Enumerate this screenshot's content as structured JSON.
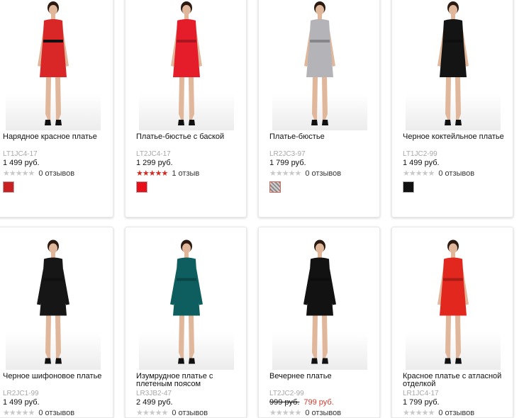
{
  "colors": {
    "accent": "#d62a20",
    "sale_price": "#d23a2e",
    "sku_gray": "#a8a8a8"
  },
  "products": [
    {
      "title": "Нарядное красное платье",
      "sku": "LT1JC4-17",
      "price": "1 499 руб.",
      "stars": 0,
      "reviews": "0 отзывов",
      "color": "#cc1f22",
      "dress": "#d92626",
      "sleeves": false,
      "icon": "dress-red-belted-icon"
    },
    {
      "title": "Платье-бюстье с баской",
      "sku": "LT2JC4-17",
      "price": "1 299 руб.",
      "stars": 5,
      "reviews": "1 отзыв",
      "color": "#e8101a",
      "dress": "#e51c2a",
      "sleeves": false,
      "icon": "dress-red-peplum-icon"
    },
    {
      "title": "Платье-бюстье",
      "sku": "LR2JC3-97",
      "price": "1 799 руб.",
      "stars": 0,
      "reviews": "0 отзывов",
      "color": "pattern",
      "dress": "#b4b4b8",
      "sleeves": false,
      "icon": "dress-silver-bustier-icon"
    },
    {
      "title": "Черное коктейльное платье",
      "sku": "LT1JC2-99",
      "price": "1 499 руб.",
      "stars": 0,
      "reviews": "0 отзывов",
      "color": "#111111",
      "dress": "#141414",
      "sleeves": false,
      "icon": "dress-black-cocktail-icon"
    },
    {
      "title": "Черное шифоновое платье",
      "sku": "LR2JC1-99",
      "price": "1 499 руб.",
      "stars": 0,
      "reviews": "0 отзывов",
      "color": "#111111",
      "dress": "#161616",
      "sleeves": true,
      "icon": "dress-black-chiffon-icon"
    },
    {
      "title": "Изумрудное платье с плетеным поясом",
      "sku": "LR3JB2-47",
      "price": "2 499 руб.",
      "stars": 0,
      "reviews": "0 отзывов",
      "color": "#0b5a57",
      "dress": "#0f5e5f",
      "sleeves": true,
      "icon": "dress-emerald-icon"
    },
    {
      "title": "Вечернее платье",
      "sku": "LT2JC2-99",
      "price_old": "999 руб.",
      "price": "799 руб.",
      "stars": 0,
      "reviews": "0 отзывов",
      "color": "#111111",
      "dress": "#121212",
      "sleeves": true,
      "icon": "dress-black-evening-icon"
    },
    {
      "title": "Красное платье с атласной отделкой",
      "sku": "LR1JC4-17",
      "price": "1 799 руб.",
      "stars": 0,
      "reviews": "0 отзывов",
      "color": "#d9251f",
      "dress": "#e2271f",
      "sleeves": false,
      "icon": "dress-red-satin-icon"
    }
  ]
}
